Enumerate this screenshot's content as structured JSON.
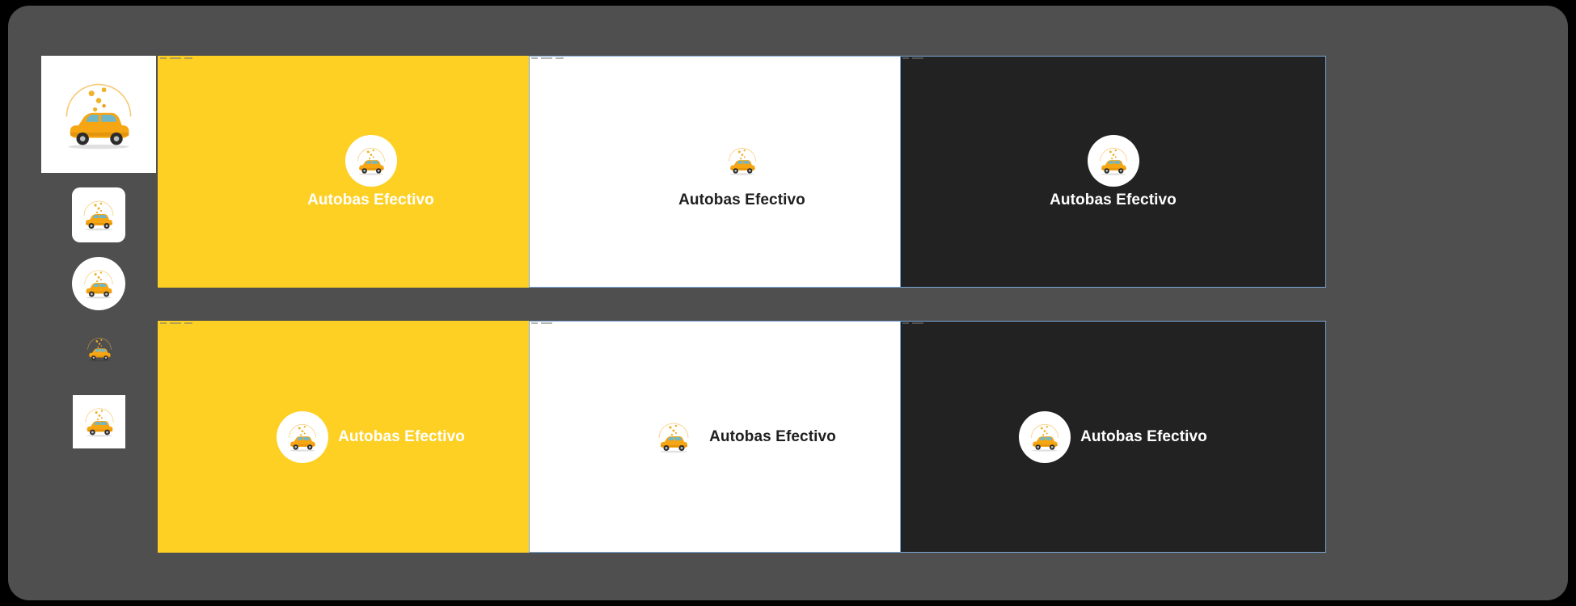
{
  "brand": {
    "name": "Autobas Efectivo"
  },
  "colors": {
    "canvas": "#4f4f4f",
    "yellow": "#fdd023",
    "dark": "#222222",
    "white": "#ffffff",
    "car_body": "#f6a613",
    "car_window": "#6fb7c7"
  },
  "icon_variants": [
    {
      "name": "logo-large-square"
    },
    {
      "name": "logo-rounded-square"
    },
    {
      "name": "logo-circle"
    },
    {
      "name": "logo-transparent"
    },
    {
      "name": "logo-small-square"
    }
  ],
  "mockups": [
    {
      "theme": "yellow",
      "layout": "stacked"
    },
    {
      "theme": "white",
      "layout": "stacked"
    },
    {
      "theme": "dark",
      "layout": "stacked"
    },
    {
      "theme": "yellow",
      "layout": "inline"
    },
    {
      "theme": "white",
      "layout": "inline"
    },
    {
      "theme": "dark",
      "layout": "inline"
    }
  ]
}
